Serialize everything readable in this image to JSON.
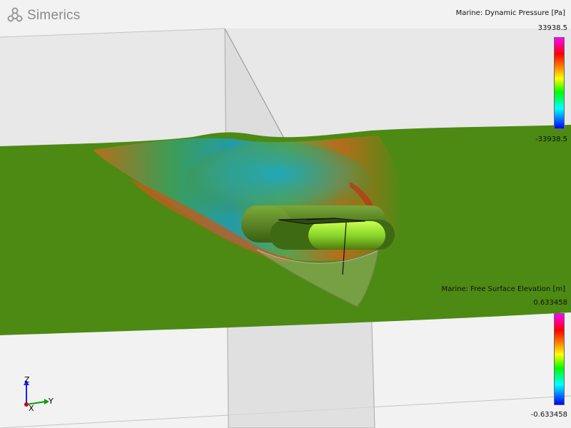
{
  "app": {
    "brand": "Simerics",
    "logo_icon": "simerics-logo-icon"
  },
  "legend_pressure": {
    "title": "Marine: Dynamic Pressure [Pa]",
    "max": "33938.5",
    "min": "-33938.5"
  },
  "legend_elevation": {
    "title": "Marine: Free Surface Elevation [m]",
    "max": "0.633458",
    "min": "-0.633458"
  },
  "axes": {
    "z": "Z",
    "y": "Y",
    "x": "X"
  },
  "colors": {
    "z_axis": "#1a1aff",
    "y_axis": "#00a000",
    "x_axis": "#d00000",
    "water": "#4c8a14",
    "hull": "#6aa82a"
  }
}
